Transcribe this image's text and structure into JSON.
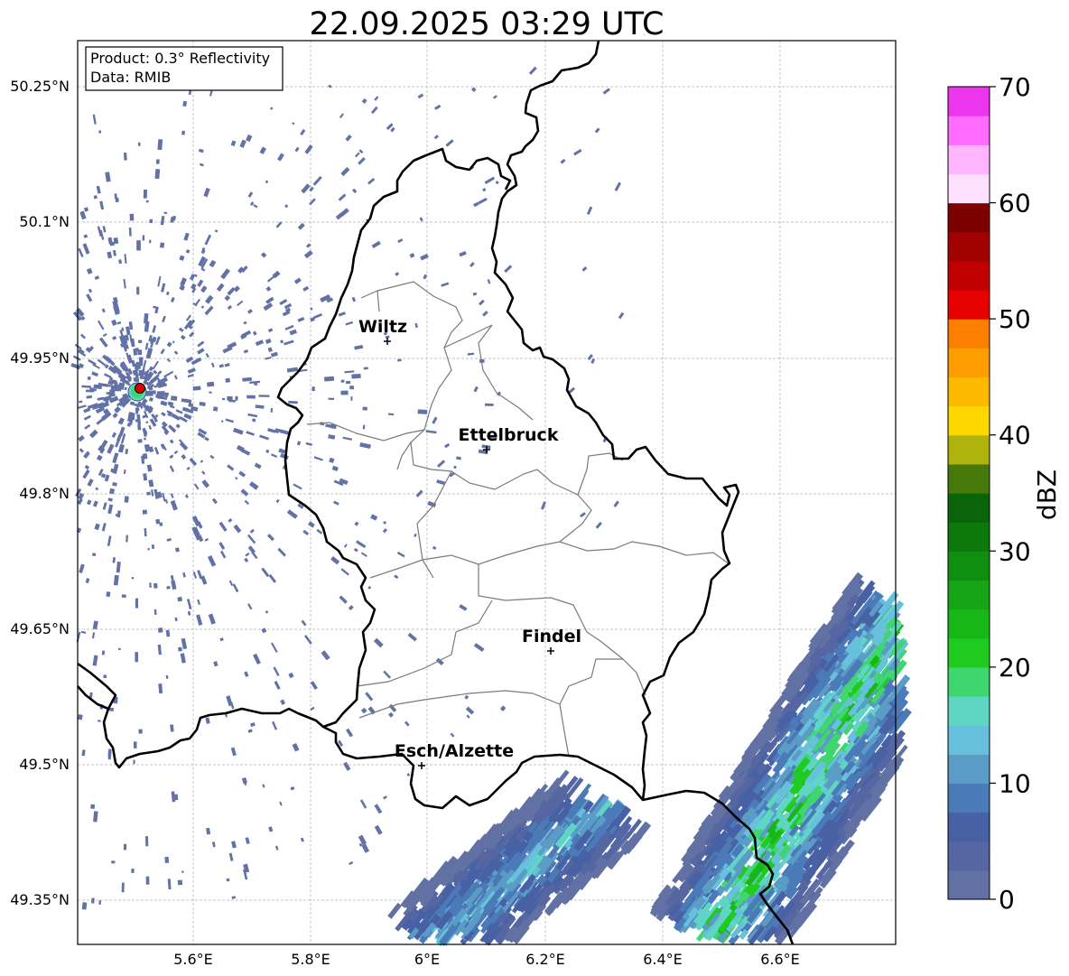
{
  "title": "22.09.2025 03:29 UTC",
  "info_box": {
    "product": "Product: 0.3° Reflectivity",
    "data": "Data: RMIB"
  },
  "lat_ticks": [
    "50.25°N",
    "50.1°N",
    "49.95°N",
    "49.8°N",
    "49.65°N",
    "49.5°N",
    "49.35°N"
  ],
  "lon_ticks": [
    "5.6°E",
    "5.8°E",
    "6°E",
    "6.2°E",
    "6.4°E",
    "6.6°E"
  ],
  "cities": [
    {
      "name": "Wiltz"
    },
    {
      "name": "Ettelbruck"
    },
    {
      "name": "Findel"
    },
    {
      "name": "Esch/Alzette"
    }
  ],
  "colorbar": {
    "label": "dBZ",
    "ticks": [
      "0",
      "10",
      "20",
      "30",
      "40",
      "50",
      "60",
      "70"
    ],
    "range": [
      0,
      70
    ],
    "colors": [
      "#6271a3",
      "#5566a2",
      "#4761a4",
      "#4a7bb8",
      "#5a9cc6",
      "#68c1dc",
      "#5fd6c4",
      "#3fd56f",
      "#1ecb1e",
      "#17b717",
      "#16a516",
      "#0f8f0f",
      "#0b7a0b",
      "#0a650a",
      "#457a0b",
      "#afb30c",
      "#fed700",
      "#fdb900",
      "#fd9d00",
      "#fd7f00",
      "#e60000",
      "#c00000",
      "#a10000",
      "#7d0000",
      "#ffe0ff",
      "#ffb5ff",
      "#ff6cff",
      "#ee35ee"
    ]
  }
}
